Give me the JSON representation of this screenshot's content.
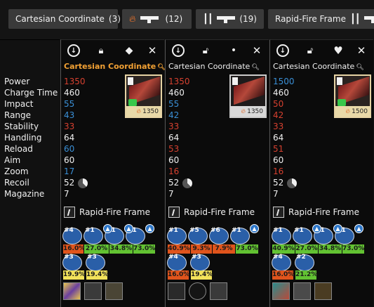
{
  "filters": [
    {
      "label": "Cartesian Coordinate",
      "count": "(3)",
      "icon": "none"
    },
    {
      "label": "",
      "count": "(12)",
      "icon": "flame-gun-icon"
    },
    {
      "label": "",
      "count": "(19)",
      "icon": "bars-gun-icon"
    },
    {
      "label": "Rapid-Fire Frame",
      "count": "",
      "icon": "bars-gun-icon"
    }
  ],
  "stat_labels": [
    "Power",
    "Charge Time",
    "Impact",
    "Range",
    "Stability",
    "Handling",
    "Reload",
    "Aim",
    "Zoom",
    "Recoil",
    "Magazine"
  ],
  "items": [
    {
      "name": "Cartesian Coordinate",
      "power_thumb": "1350",
      "stats": [
        "1350",
        "460",
        "55",
        "43",
        "33",
        "64",
        "60",
        "60",
        "17",
        "52",
        "7"
      ],
      "frame": "Rapid-Fire Frame",
      "perk_labels_row1": [
        "#4",
        "#1",
        "#1",
        "#1"
      ],
      "perk_pct_row1": [
        "16.0%",
        "27.0%",
        "34.8%",
        "73.0%"
      ],
      "perk_labels_row2": [
        "#3",
        "#3"
      ],
      "perk_pct_row2": [
        "19.9%",
        "19.4%"
      ]
    },
    {
      "name": "Cartesian Coordinate",
      "power_thumb": "1350",
      "stats": [
        "1350",
        "460",
        "55",
        "42",
        "33",
        "64",
        "53",
        "60",
        "16",
        "52",
        "7"
      ],
      "frame": "Rapid-Fire Frame",
      "perk_labels_row1": [
        "#1",
        "#5",
        "#6",
        "#1"
      ],
      "perk_pct_row1": [
        "40.9%",
        "9.3%",
        "7.9%",
        "73.0%"
      ],
      "perk_labels_row2": [
        "#4",
        "#3"
      ],
      "perk_pct_row2": [
        "16.0%",
        "19.4%"
      ]
    },
    {
      "name": "Cartesian Coordinate",
      "power_thumb": "1500",
      "stats": [
        "1500",
        "460",
        "50",
        "42",
        "33",
        "64",
        "51",
        "60",
        "16",
        "52",
        "7"
      ],
      "frame": "Rapid-Fire Frame",
      "perk_labels_row1": [
        "#1",
        "#1",
        "#1",
        "#1"
      ],
      "perk_pct_row1": [
        "40.9%",
        "27.0%",
        "34.8%",
        "73.0%"
      ],
      "perk_labels_row2": [
        "#4",
        "#2"
      ],
      "perk_pct_row2": [
        "16.0%",
        "21.2%"
      ]
    }
  ],
  "colors": {
    "accent_gold": "#f2a134",
    "stat_red": "#d5402f",
    "stat_blue": "#3a8fd6"
  }
}
